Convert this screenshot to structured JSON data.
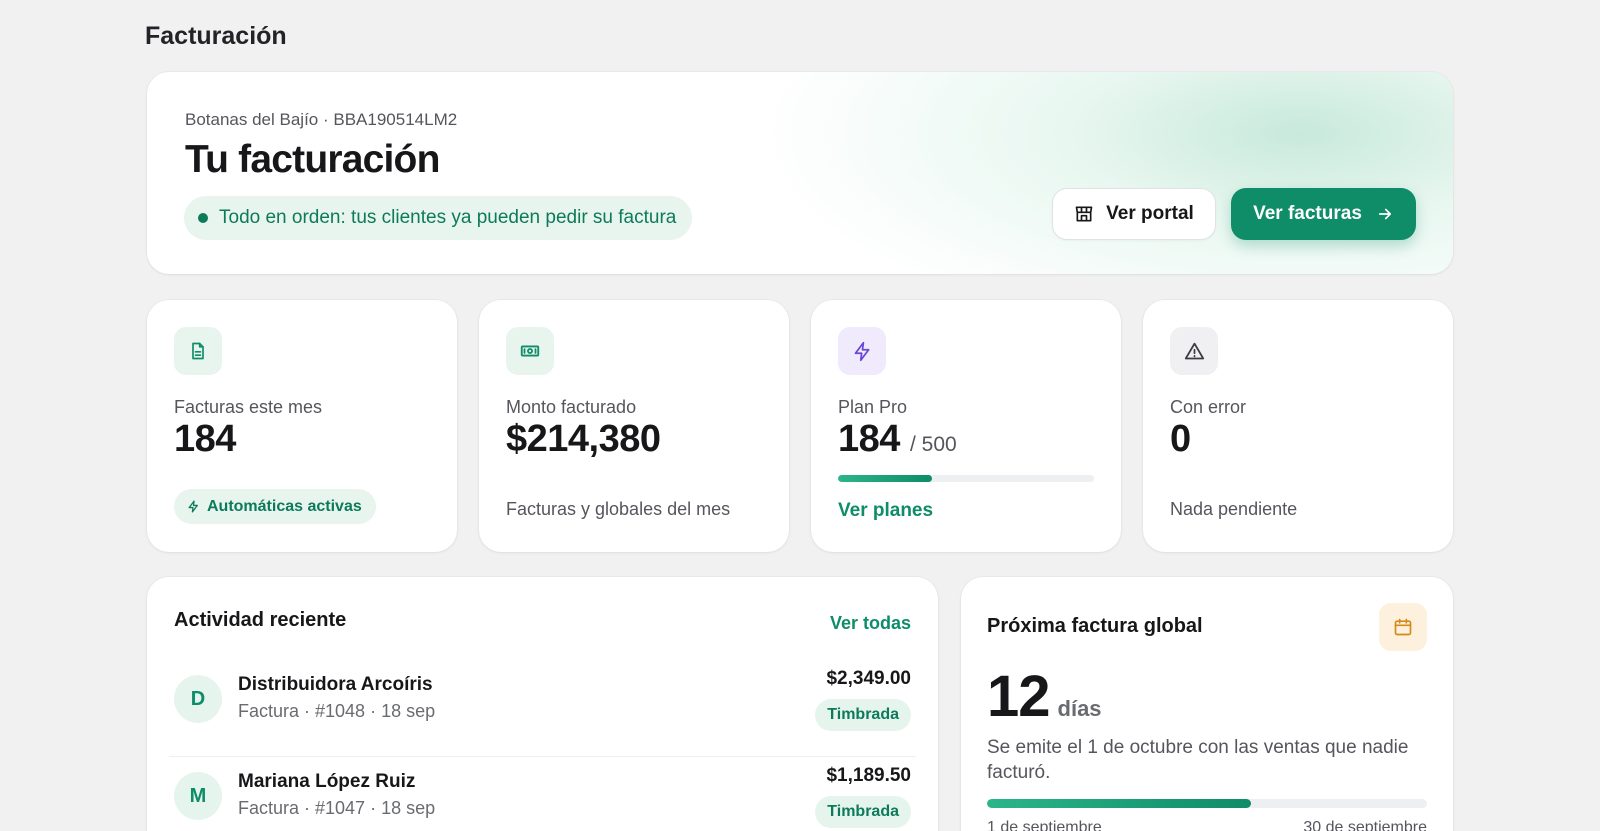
{
  "page": {
    "title": "Facturación"
  },
  "hero": {
    "business": "Botanas del Bajío · BBA190514LM2",
    "title": "Tu facturación",
    "status": "Todo en orden: tus clientes ya pueden pedir su factura",
    "portal_button": "Ver portal",
    "invoices_button": "Ver facturas"
  },
  "stats": {
    "invoices": {
      "label": "Facturas este mes",
      "value": "184",
      "badge": "Automáticas activas",
      "icon": "document-icon"
    },
    "amount": {
      "label": "Monto facturado",
      "value": "$214,380",
      "footnote": "Facturas y globales del mes",
      "icon": "banknote-icon"
    },
    "plan": {
      "label": "Plan Pro",
      "value": "184",
      "denominator": "/ 500",
      "progress": 0.368,
      "link": "Ver planes",
      "icon": "bolt-icon"
    },
    "errors": {
      "label": "Con error",
      "value": "0",
      "footnote": "Nada pendiente",
      "icon": "warning-icon"
    }
  },
  "activity": {
    "title": "Actividad reciente",
    "view_all": "Ver todas",
    "items": [
      {
        "initial": "D",
        "name": "Distribuidora Arcoíris",
        "meta": "Factura · #1048 · 18 sep",
        "amount": "$2,349.00",
        "status": "Timbrada"
      },
      {
        "initial": "M",
        "name": "Mariana López Ruiz",
        "meta": "Factura · #1047 · 18 sep",
        "amount": "$1,189.50",
        "status": "Timbrada"
      }
    ]
  },
  "global_invoice": {
    "title": "Próxima factura global",
    "days": "12",
    "days_unit": "días",
    "description": "Se emite el 1 de octubre con las ventas que nadie facturó.",
    "progress": 0.6,
    "start_label": "1 de septiembre",
    "end_label": "30 de septiembre",
    "icon": "calendar-icon"
  },
  "colors": {
    "accent": "#0f8c68",
    "accent_light": "#e8f5ef",
    "warning_bg": "#fdf0dd",
    "plan_bg": "#efeafc",
    "background": "#f1f1f2"
  }
}
